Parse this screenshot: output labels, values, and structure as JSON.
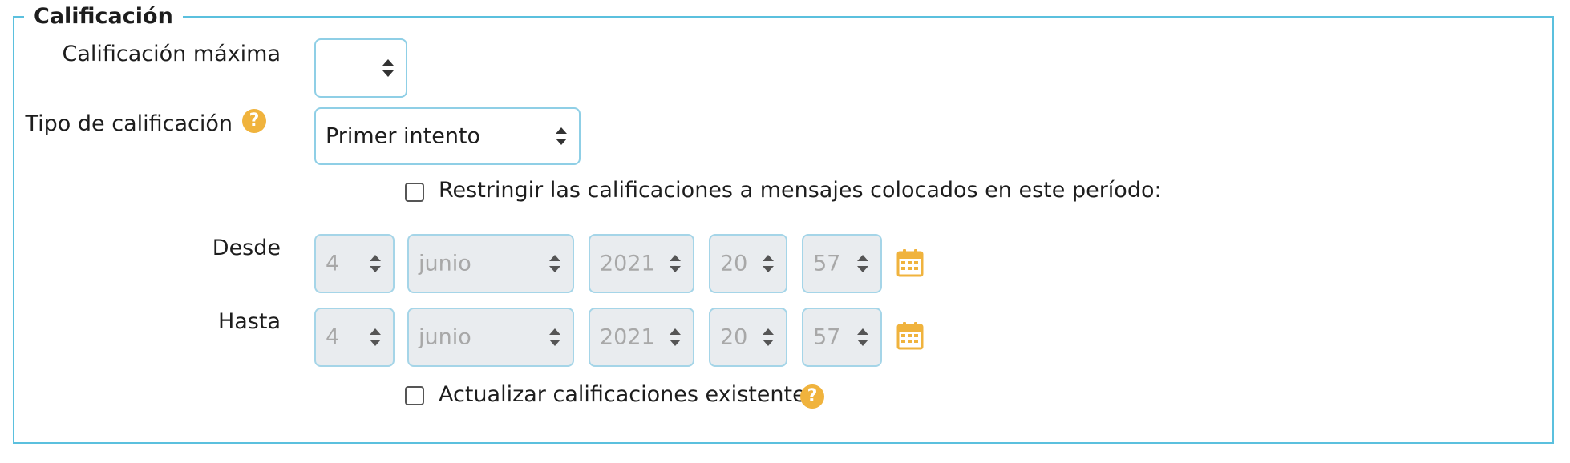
{
  "section": {
    "legend": "Calificación"
  },
  "max_grade": {
    "label": "Calificación máxima",
    "value": ""
  },
  "grade_type": {
    "label": "Tipo de calificación",
    "value": "Primer intento"
  },
  "restrict": {
    "label": "Restringir las calificaciones a mensajes colocados en este período:",
    "checked": false
  },
  "from": {
    "label": "Desde",
    "day": "4",
    "month": "junio",
    "year": "2021",
    "hour": "20",
    "minute": "57"
  },
  "to": {
    "label": "Hasta",
    "day": "4",
    "month": "junio",
    "year": "2021",
    "hour": "20",
    "minute": "57"
  },
  "update_existing": {
    "label": "Actualizar calificaciones existentes",
    "checked": false
  },
  "colors": {
    "accent_border": "#5bc0de",
    "help_icon": "#f0b33d",
    "calendar_icon": "#f0b33d"
  },
  "icons": {
    "help": "question-circle-icon",
    "calendar": "calendar-icon",
    "select_arrows": "sort-arrows-icon"
  }
}
